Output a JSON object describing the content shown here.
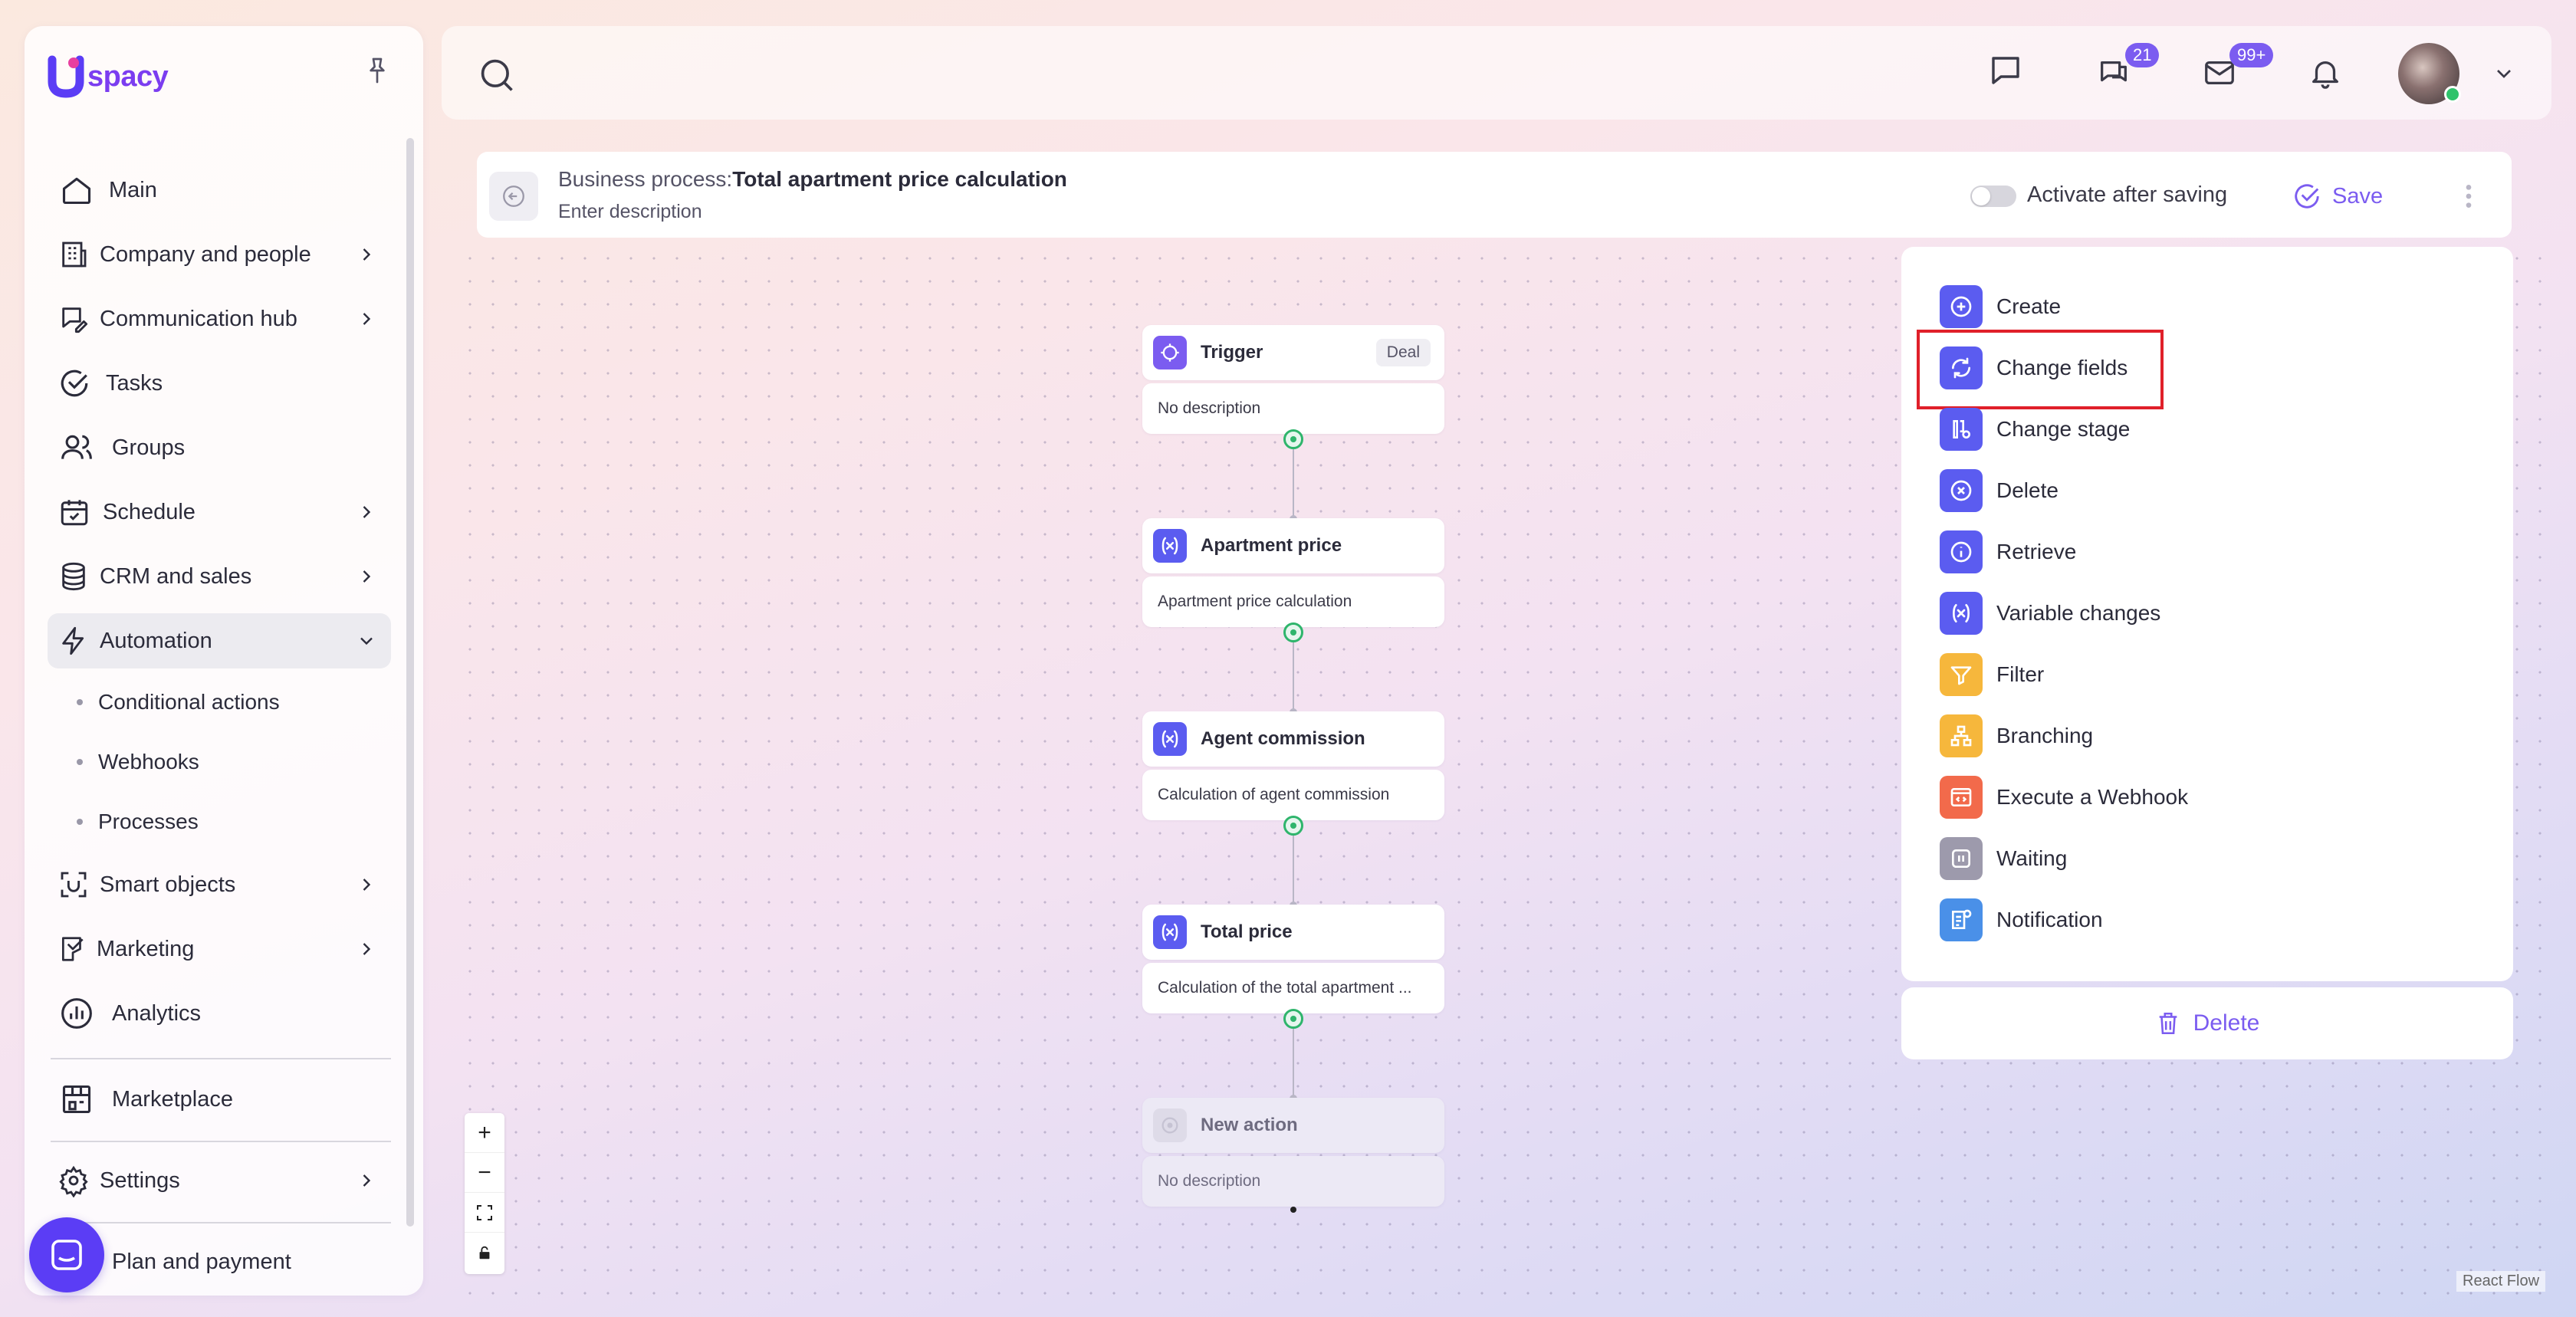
{
  "sidebar": {
    "logo_text": "spacy",
    "items": [
      {
        "label": "Main",
        "icon": "home-icon"
      },
      {
        "label": "Company and people",
        "icon": "building-icon"
      },
      {
        "label": "Communication hub",
        "icon": "chat-edit-icon"
      },
      {
        "label": "Tasks",
        "icon": "check-circle-icon"
      },
      {
        "label": "Groups",
        "icon": "users-icon"
      },
      {
        "label": "Schedule",
        "icon": "calendar-icon"
      },
      {
        "label": "CRM and sales",
        "icon": "coins-icon"
      },
      {
        "label": "Automation",
        "icon": "lightning-icon"
      },
      {
        "label": "Smart objects",
        "icon": "scan-icon"
      },
      {
        "label": "Marketing",
        "icon": "megaphone-icon"
      },
      {
        "label": "Analytics",
        "icon": "chart-icon"
      },
      {
        "label": "Marketplace",
        "icon": "store-icon"
      },
      {
        "label": "Settings",
        "icon": "gear-icon"
      },
      {
        "label": "Plan and payment",
        "icon": "card-icon"
      }
    ],
    "automation_sub": [
      "Conditional actions",
      "Webhooks",
      "Processes"
    ]
  },
  "topbar": {
    "chat_badge": "21",
    "mail_badge": "99+"
  },
  "process": {
    "title_prefix": "Business process:",
    "title": "Total apartment price calculation",
    "description_placeholder": "Enter description",
    "activate_label": "Activate after saving",
    "save_label": "Save"
  },
  "flow": {
    "nodes": [
      {
        "title": "Trigger",
        "tag": "Deal",
        "description": "No description"
      },
      {
        "title": "Apartment price",
        "description": "Apartment price calculation"
      },
      {
        "title": "Agent commission",
        "description": "Calculation of agent commission"
      },
      {
        "title": "Total price",
        "description": "Calculation of the total apartment ..."
      },
      {
        "title": "New action",
        "description": "No description"
      }
    ],
    "attribution": "React Flow"
  },
  "actions": {
    "items": [
      {
        "label": "Create",
        "icon": "plus-circle-icon",
        "color": "#5b5cf0"
      },
      {
        "label": "Change fields",
        "icon": "refresh-icon",
        "color": "#5b5cf0"
      },
      {
        "label": "Change stage",
        "icon": "stage-icon",
        "color": "#5b5cf0"
      },
      {
        "label": "Delete",
        "icon": "x-circle-icon",
        "color": "#5b5cf0"
      },
      {
        "label": "Retrieve",
        "icon": "info-icon",
        "color": "#5b5cf0"
      },
      {
        "label": "Variable changes",
        "icon": "variable-icon",
        "color": "#5b5cf0"
      },
      {
        "label": "Filter",
        "icon": "funnel-icon",
        "color": "#f6b73c"
      },
      {
        "label": "Branching",
        "icon": "branch-icon",
        "color": "#f6b73c"
      },
      {
        "label": "Execute a Webhook",
        "icon": "webhook-icon",
        "color": "#f26a4b"
      },
      {
        "label": "Waiting",
        "icon": "pause-icon",
        "color": "#9d9aac"
      },
      {
        "label": "Notification",
        "icon": "notification-icon",
        "color": "#4a90e8"
      }
    ],
    "delete_label": "Delete"
  }
}
